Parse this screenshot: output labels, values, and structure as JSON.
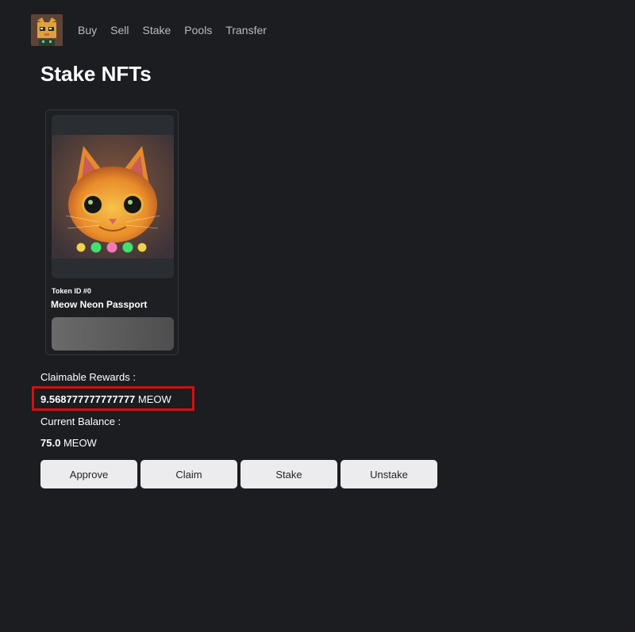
{
  "nav": {
    "logo_icon": "cat-logo-icon",
    "links": [
      "Buy",
      "Sell",
      "Stake",
      "Pools",
      "Transfer"
    ]
  },
  "page_title": "Stake NFTs",
  "card": {
    "image_icon": "neon-cat-image",
    "token_id": "Token ID #0",
    "name": "Meow Neon Passport"
  },
  "rewards": {
    "claimable_label": "Claimable Rewards :",
    "claimable_amount": "9.568777777777777",
    "claimable_unit": "MEOW",
    "balance_label": "Current Balance :",
    "balance_amount": "75.0",
    "balance_unit": "MEOW"
  },
  "actions": [
    "Approve",
    "Claim",
    "Stake",
    "Unstake"
  ],
  "colors": {
    "background": "#1b1d20",
    "highlight": "#d40f0f",
    "button": "#ececee"
  }
}
